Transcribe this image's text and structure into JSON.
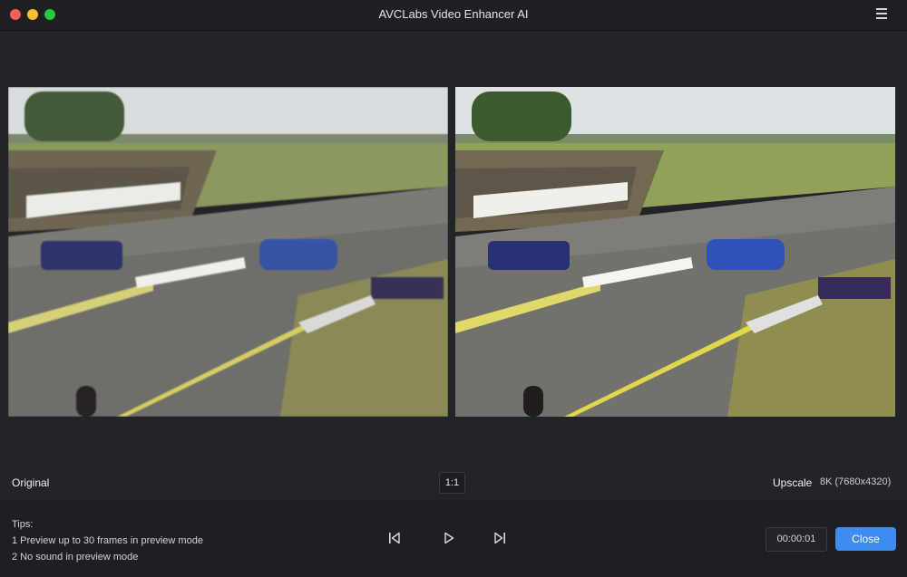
{
  "window": {
    "title": "AVCLabs Video Enhancer AI",
    "menu_icon": "hamburger-menu-icon"
  },
  "preview": {
    "original_label": "Original",
    "ratio_label": "1:1",
    "upscale_label": "Upscale",
    "upscale_resolution": "8K (7680x4320)"
  },
  "tips": {
    "heading": "Tips:",
    "line1": "1 Preview up to 30 frames in preview mode",
    "line2": "2 No sound in preview mode"
  },
  "player": {
    "prev_icon": "skip-previous-icon",
    "play_icon": "play-icon",
    "next_icon": "skip-next-icon",
    "timecode": "00:00:01",
    "close_label": "Close"
  },
  "colors": {
    "accent": "#3f8cf0",
    "background": "#26272b",
    "titlebar": "#1f2023"
  }
}
